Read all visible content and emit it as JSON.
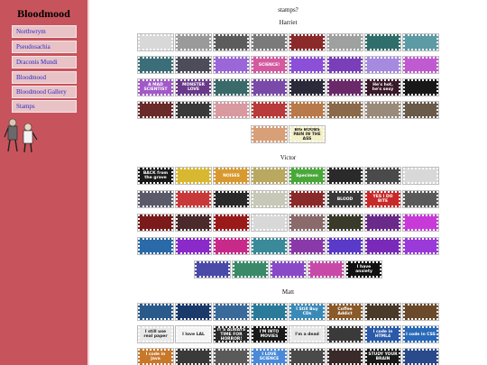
{
  "sidebar": {
    "title": "Bloodmood",
    "items": [
      {
        "label": "Northwrym"
      },
      {
        "label": "Pseudosachia"
      },
      {
        "label": "Draconis Mundi"
      },
      {
        "label": "Bloodmood"
      },
      {
        "label": "Bloodmood Gallery"
      },
      {
        "label": "Stamps"
      }
    ]
  },
  "page": {
    "title": "stamps?"
  },
  "sections": [
    {
      "heading": "Harriet",
      "rows": [
        [
          {
            "color": "#d8d8d8",
            "text": ""
          },
          {
            "color": "#9a9a9a",
            "text": ""
          },
          {
            "color": "#5c5c5c",
            "text": ""
          },
          {
            "color": "#7a7a7a",
            "text": ""
          },
          {
            "color": "#8a2a2a",
            "text": ""
          },
          {
            "color": "#9fa0a0",
            "text": ""
          },
          {
            "color": "#2f6e6a",
            "text": ""
          },
          {
            "color": "#5c9aa4",
            "text": ""
          }
        ],
        [
          {
            "color": "#3b6e78",
            "text": ""
          },
          {
            "color": "#4d4d5a",
            "text": ""
          },
          {
            "color": "#9a66d8",
            "text": ""
          },
          {
            "color": "#d45aa0",
            "text": "SCIENCE!"
          },
          {
            "color": "#8c4fd8",
            "text": ""
          },
          {
            "color": "#7a3fb8",
            "text": ""
          },
          {
            "color": "#a68ae0",
            "text": ""
          },
          {
            "color": "#c05ad0",
            "text": ""
          }
        ],
        [
          {
            "color": "#a25ac8",
            "text": "A MAD SCIENTIST"
          },
          {
            "color": "#6a3a8a",
            "text": "MONSTER LOVE"
          },
          {
            "color": "#3a6a6a",
            "text": ""
          },
          {
            "color": "#7a4aa8",
            "text": ""
          },
          {
            "color": "#2a2a3a",
            "text": ""
          },
          {
            "color": "#6a2a6a",
            "text": ""
          },
          {
            "color": "#3a1a2a",
            "text": "He's hot, he's sexy"
          },
          {
            "color": "#181818",
            "text": ""
          }
        ],
        [
          {
            "color": "#6a2a2a",
            "text": ""
          },
          {
            "color": "#3a3a3a",
            "text": ""
          },
          {
            "color": "#d89aa0",
            "text": ""
          },
          {
            "color": "#b83a3a",
            "text": ""
          },
          {
            "color": "#b87a4a",
            "text": ""
          },
          {
            "color": "#8a6a4a",
            "text": ""
          },
          {
            "color": "#9a8a7a",
            "text": ""
          },
          {
            "color": "#6a5a4a",
            "text": ""
          }
        ],
        [
          {
            "color": "#d8a078",
            "text": ""
          },
          {
            "color": "#f4f0c8",
            "text": "BIG BOOBS PAIN IN THE ASS",
            "dark": true
          }
        ]
      ]
    },
    {
      "heading": "Victor",
      "rows": [
        [
          {
            "color": "#1a1a1a",
            "text": "BACK from the grave"
          },
          {
            "color": "#d8b830",
            "text": ""
          },
          {
            "color": "#d89a30",
            "text": "NOISES"
          },
          {
            "color": "#b8a860",
            "text": ""
          },
          {
            "color": "#4aa83a",
            "text": "Specimen"
          },
          {
            "color": "#2a2a2a",
            "text": ""
          },
          {
            "color": "#4a4a4a",
            "text": ""
          },
          {
            "color": "#d8d8d8",
            "text": ""
          }
        ],
        [
          {
            "color": "#5a5a6a",
            "text": ""
          },
          {
            "color": "#c83a3a",
            "text": ""
          },
          {
            "color": "#2a2a2a",
            "text": ""
          },
          {
            "color": "#c8c8b8",
            "text": ""
          },
          {
            "color": "#8a2a2a",
            "text": ""
          },
          {
            "color": "#3a3a3a",
            "text": "BLOOD"
          },
          {
            "color": "#c82a2a",
            "text": "YES I DO BITE"
          },
          {
            "color": "#5a5a5a",
            "text": ""
          }
        ],
        [
          {
            "color": "#7a1a1a",
            "text": ""
          },
          {
            "color": "#4a2a2a",
            "text": ""
          },
          {
            "color": "#9a1a1a",
            "text": ""
          },
          {
            "color": "#d8d8d8",
            "text": ""
          },
          {
            "color": "#8a6a6a",
            "text": ""
          },
          {
            "color": "#3a3a2a",
            "text": ""
          },
          {
            "color": "#6a2a8a",
            "text": ""
          },
          {
            "color": "#c83ad8",
            "text": ""
          }
        ],
        [
          {
            "color": "#2a6aa8",
            "text": ""
          },
          {
            "color": "#8a2ac8",
            "text": ""
          },
          {
            "color": "#c82a8a",
            "text": ""
          },
          {
            "color": "#3a8a9a",
            "text": ""
          },
          {
            "color": "#8a3aa8",
            "text": ""
          },
          {
            "color": "#5a3ac8",
            "text": ""
          },
          {
            "color": "#7a2ab8",
            "text": ""
          },
          {
            "color": "#9a3ad8",
            "text": ""
          }
        ],
        [
          {
            "color": "#4a4aa8",
            "text": ""
          },
          {
            "color": "#3a8a6a",
            "text": ""
          },
          {
            "color": "#8a4ac8",
            "text": ""
          },
          {
            "color": "#c84aa8",
            "text": ""
          },
          {
            "color": "#111111",
            "text": "I have anxiety"
          }
        ]
      ]
    },
    {
      "heading": "Matt",
      "rows": [
        [
          {
            "color": "#2a5a8a",
            "text": ""
          },
          {
            "color": "#1a3a6a",
            "text": ""
          },
          {
            "color": "#3a6a9a",
            "text": ""
          },
          {
            "color": "#2a7a9a",
            "text": ""
          },
          {
            "color": "#3a8ab8",
            "text": "I Still Buy CDs"
          },
          {
            "color": "#8a5a2a",
            "text": "Coffee Addict"
          },
          {
            "color": "#4a3a2a",
            "text": ""
          },
          {
            "color": "#6a4a2a",
            "text": ""
          }
        ],
        [
          {
            "color": "#e8e8e8",
            "text": "I still use real paper",
            "dark": true
          },
          {
            "color": "#f4f4f4",
            "text": "I love LAL",
            "dark": true
          },
          {
            "color": "#2a2a2a",
            "text": "IT'S ALWAYS TIME FOR HORROR!"
          },
          {
            "color": "#1a1a1a",
            "text": "I'M INTO MOVIES"
          },
          {
            "color": "#e8e8e8",
            "text": "I'm a dead",
            "dark": true
          },
          {
            "color": "#3a3a3a",
            "text": ""
          },
          {
            "color": "#2a5aa8",
            "text": "I code in HTML4"
          },
          {
            "color": "#2a6ab8",
            "text": "I code in CSS"
          }
        ],
        [
          {
            "color": "#c8782a",
            "text": "I code in Java"
          },
          {
            "color": "#3a3a3a",
            "text": ""
          },
          {
            "color": "#5a5a5a",
            "text": ""
          },
          {
            "color": "#4a8ad8",
            "text": "I LOVE SCIENCE"
          },
          {
            "color": "#4a4a4a",
            "text": ""
          },
          {
            "color": "#3a2a2a",
            "text": ""
          },
          {
            "color": "#1a1a1a",
            "text": "STUDY YOUR BRAIN"
          },
          {
            "color": "#2a4a8a",
            "text": ""
          }
        ]
      ]
    }
  ]
}
